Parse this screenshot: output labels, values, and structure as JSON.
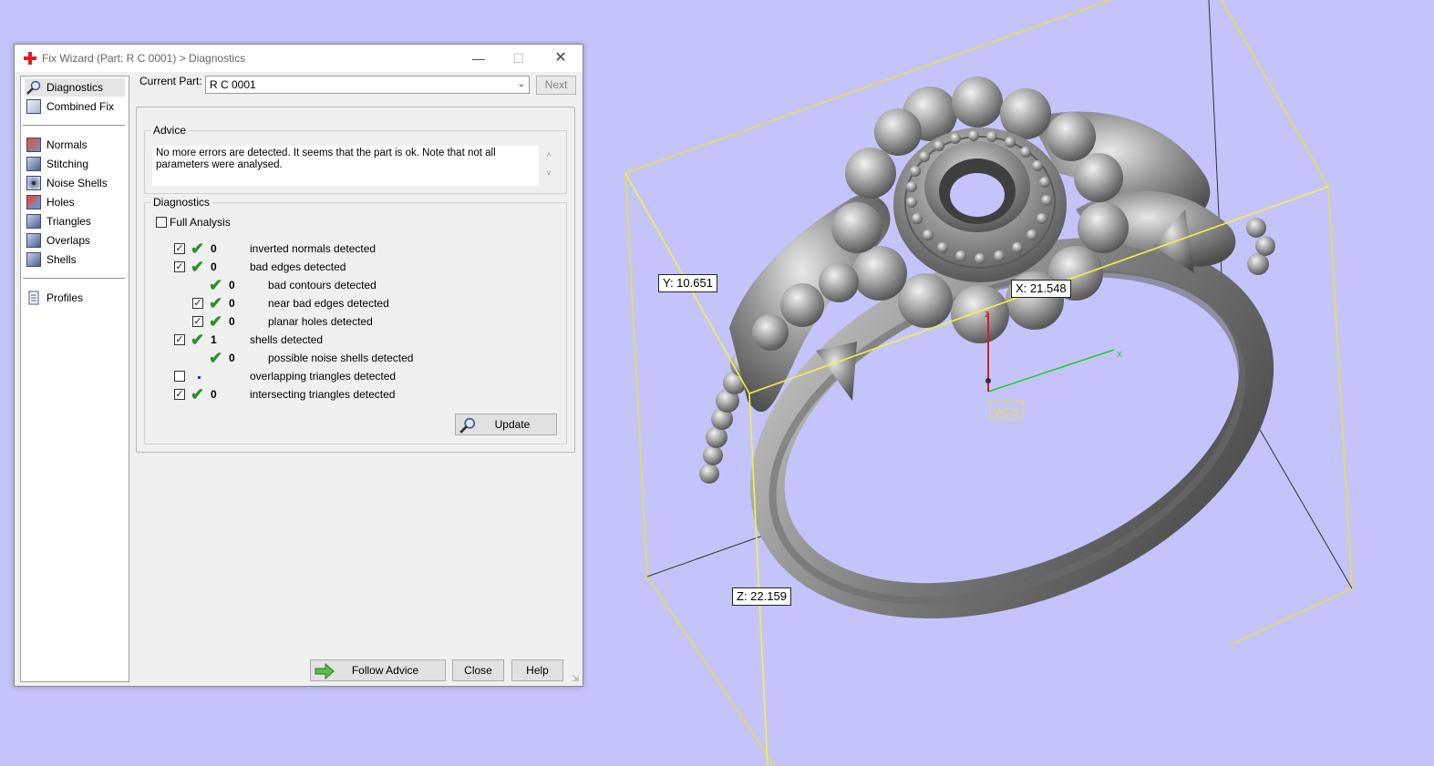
{
  "window": {
    "title": "Fix Wizard (Part: R C 0001) > Diagnostics",
    "min_icon": "minimize-icon",
    "max_icon": "maximize-icon",
    "close_icon": "close-icon"
  },
  "sidebar": {
    "items": [
      {
        "label": "Diagnostics",
        "icon": "magnifier-icon",
        "selected": true
      },
      {
        "label": "Combined Fix",
        "icon": "combined-fix-icon"
      },
      {
        "label": "Normals",
        "icon": "normals-cube-icon"
      },
      {
        "label": "Stitching",
        "icon": "stitching-cube-icon"
      },
      {
        "label": "Noise Shells",
        "icon": "noise-shells-cube-icon"
      },
      {
        "label": "Holes",
        "icon": "holes-cube-icon"
      },
      {
        "label": "Triangles",
        "icon": "triangles-cube-icon"
      },
      {
        "label": "Overlaps",
        "icon": "overlaps-cube-icon"
      },
      {
        "label": "Shells",
        "icon": "shells-cube-icon"
      },
      {
        "label": "Profiles",
        "icon": "document-icon"
      }
    ]
  },
  "current_part": {
    "label": "Current Part:",
    "value": "R C 0001",
    "next_label": "Next"
  },
  "advice": {
    "title": "Advice",
    "text": "No more errors are detected. It seems that the part is ok. Note that not all parameters were analysed."
  },
  "diagnostics": {
    "title": "Diagnostics",
    "full_analysis_label": "Full Analysis",
    "full_analysis_checked": false,
    "rows": [
      {
        "checked": true,
        "status": "ok",
        "count": "0",
        "label": "inverted normals detected"
      },
      {
        "checked": true,
        "status": "ok",
        "count": "0",
        "label": "bad edges detected"
      },
      {
        "checked": null,
        "status": "ok",
        "count": "0",
        "label": "bad contours detected"
      },
      {
        "checked": true,
        "status": "ok",
        "count": "0",
        "label": "near bad edges detected"
      },
      {
        "checked": true,
        "status": "ok",
        "count": "0",
        "label": "planar holes detected"
      },
      {
        "checked": true,
        "status": "ok",
        "count": "1",
        "label": "shells detected"
      },
      {
        "checked": null,
        "status": "ok",
        "count": "0",
        "label": "possible noise shells detected"
      },
      {
        "checked": false,
        "status": "unknown",
        "count": "",
        "label": "overlapping triangles detected"
      },
      {
        "checked": true,
        "status": "ok",
        "count": "0",
        "label": "intersecting triangles detected"
      }
    ],
    "update_label": "Update"
  },
  "footer": {
    "follow_advice_label": "Follow Advice",
    "close_label": "Close",
    "help_label": "Help"
  },
  "viewport": {
    "dim_y": "Y: 10.651",
    "dim_x": "X: 21.548",
    "dim_z": "Z: 22.159",
    "axis_x": "x",
    "axis_z": "z",
    "wcs": "WCS",
    "bbox_color": "#f2f04a",
    "background_color": "#c4c4fb",
    "x_axis_color": "#22cc22",
    "z_axis_color": "#cc2222"
  }
}
